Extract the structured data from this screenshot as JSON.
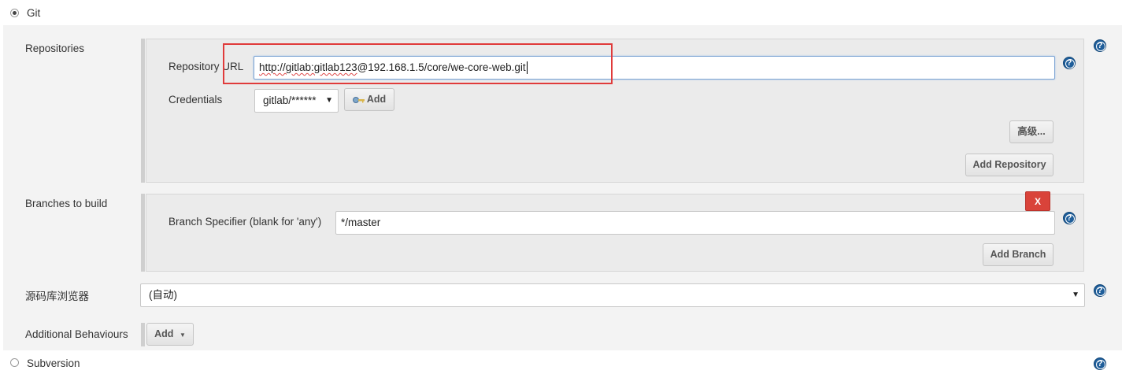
{
  "scm": {
    "git_label": "Git",
    "subversion_label": "Subversion"
  },
  "repositories": {
    "section_label": "Repositories",
    "url_label": "Repository URL",
    "url_value_part1": "http://gitlab:gitlab123",
    "url_value_part2": "@192.168.1.5/core/we-core-web.git",
    "credentials_label": "Credentials",
    "credentials_value": "gitlab/******",
    "add_credentials_label": "Add",
    "advanced_button": "高级...",
    "add_repository_button": "Add Repository"
  },
  "branches": {
    "section_label": "Branches to build",
    "specifier_label": "Branch Specifier (blank for 'any')",
    "specifier_value": "*/master",
    "delete_label": "X",
    "add_branch_button": "Add Branch"
  },
  "browser": {
    "label": "源码库浏览器",
    "value": "(自动)"
  },
  "behaviours": {
    "label": "Additional Behaviours",
    "add_button": "Add"
  },
  "help": {
    "glyph": "?"
  },
  "icons": {
    "caret": "▼",
    "key": "key-icon"
  },
  "colors": {
    "highlight_box": "#e03b3b",
    "delete_button": "#d9433a",
    "help_icon": "#1f5e9a"
  }
}
